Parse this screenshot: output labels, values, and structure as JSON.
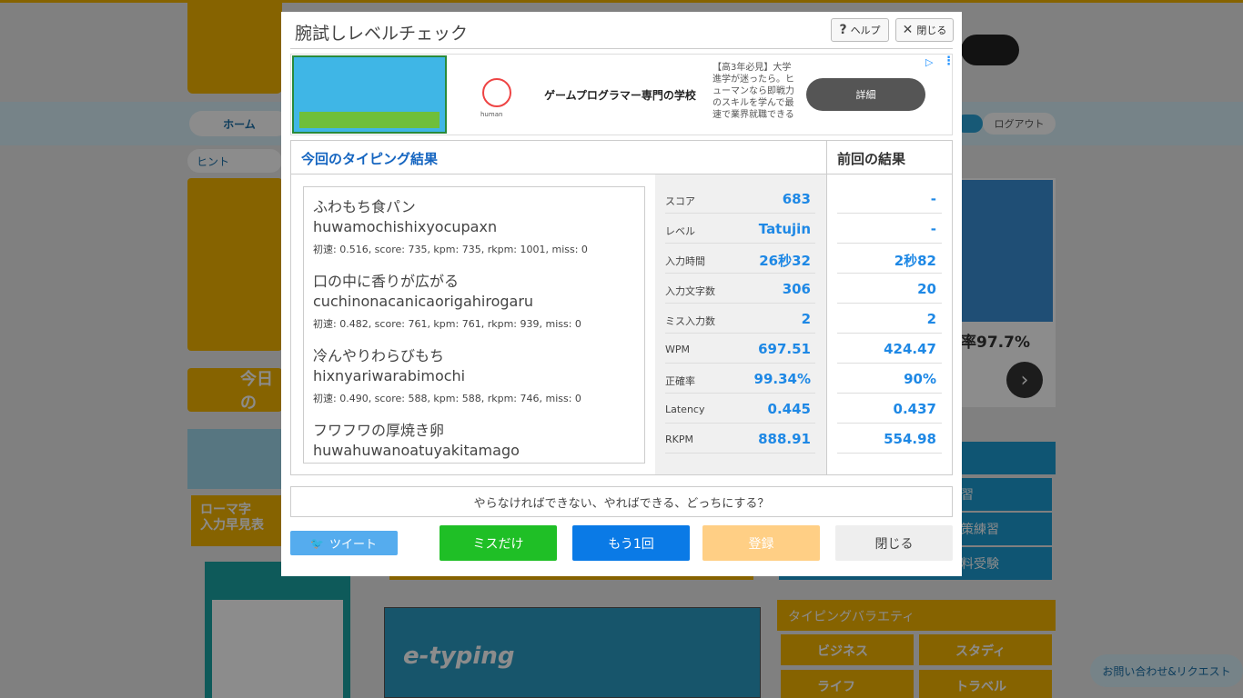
{
  "background": {
    "nav_home": "ホーム",
    "nav_logout": "ログアウト",
    "hint": "ヒント",
    "today": "今日の",
    "side_box": "ローマ字\n入力早見表",
    "etyping": "e-typing",
    "ad_right_rate": "率97.7%",
    "right_buttons": [
      "習",
      "策練習",
      "料受験"
    ],
    "variety_title": "タイピングバラエティ",
    "variety_items": [
      "ビジネス",
      "スタディ",
      "ライフ",
      "トラベル"
    ],
    "contact": "お問い合わせ&リクエスト"
  },
  "modal": {
    "title": "腕試しレベルチェック",
    "help_label": "ヘルプ",
    "close_label": "閉じる",
    "ad": {
      "school": "ゲームプログラマー専門の学校",
      "desc": "【高3年必見】大学進学が迷ったら。ヒューマンなら即戦力のスキルを学んで最速で業界就職できる",
      "button": "詳細",
      "logo_text": "human"
    },
    "results_title": "今回のタイピング結果",
    "previous_title": "前回の結果",
    "words": [
      {
        "jp": "ふわもち食パン",
        "romaji": "huwamochishixyocupaxn",
        "stats": "初速: 0.516, score: 735, kpm: 735, rkpm: 1001, miss: 0"
      },
      {
        "jp": "口の中に香りが広がる",
        "romaji": "cuchinonacanicaorigahirogaru",
        "stats": "初速: 0.482, score: 761, kpm: 761, rkpm: 939, miss: 0"
      },
      {
        "jp": "冷んやりわらびもち",
        "romaji": "hixnyariwarabimochi",
        "stats": "初速: 0.490, score: 588, kpm: 588, rkpm: 746, miss: 0"
      },
      {
        "jp": "フワフワの厚焼き卵",
        "romaji": "huwahuwanoatuyakitamago",
        "stats": ""
      }
    ],
    "stats": [
      {
        "label": "スコア",
        "current": "683",
        "previous": "-"
      },
      {
        "label": "レベル",
        "current": "Tatujin",
        "previous": "-"
      },
      {
        "label": "入力時間",
        "current": "26秒32",
        "previous": "2秒82"
      },
      {
        "label": "入力文字数",
        "current": "306",
        "previous": "20"
      },
      {
        "label": "ミス入力数",
        "current": "2",
        "previous": "2"
      },
      {
        "label": "WPM",
        "current": "697.51",
        "previous": "424.47"
      },
      {
        "label": "正確率",
        "current": "99.34%",
        "previous": "90%"
      },
      {
        "label": "Latency",
        "current": "0.445",
        "previous": "0.437"
      },
      {
        "label": "RKPM",
        "current": "888.91",
        "previous": "554.98"
      }
    ],
    "quote": "やらなければできない、やればできる、どっちにする？",
    "buttons": {
      "tweet": "ツイート",
      "miss_only": "ミスだけ",
      "again": "もう1回",
      "register": "登録",
      "close": "閉じる"
    },
    "colors": {
      "accent_blue": "#1e88e5",
      "miss_green": "#1fbf26",
      "again_blue": "#0a7ae6",
      "register_orange": "#ffcf85",
      "tweet_blue": "#55acee"
    }
  }
}
